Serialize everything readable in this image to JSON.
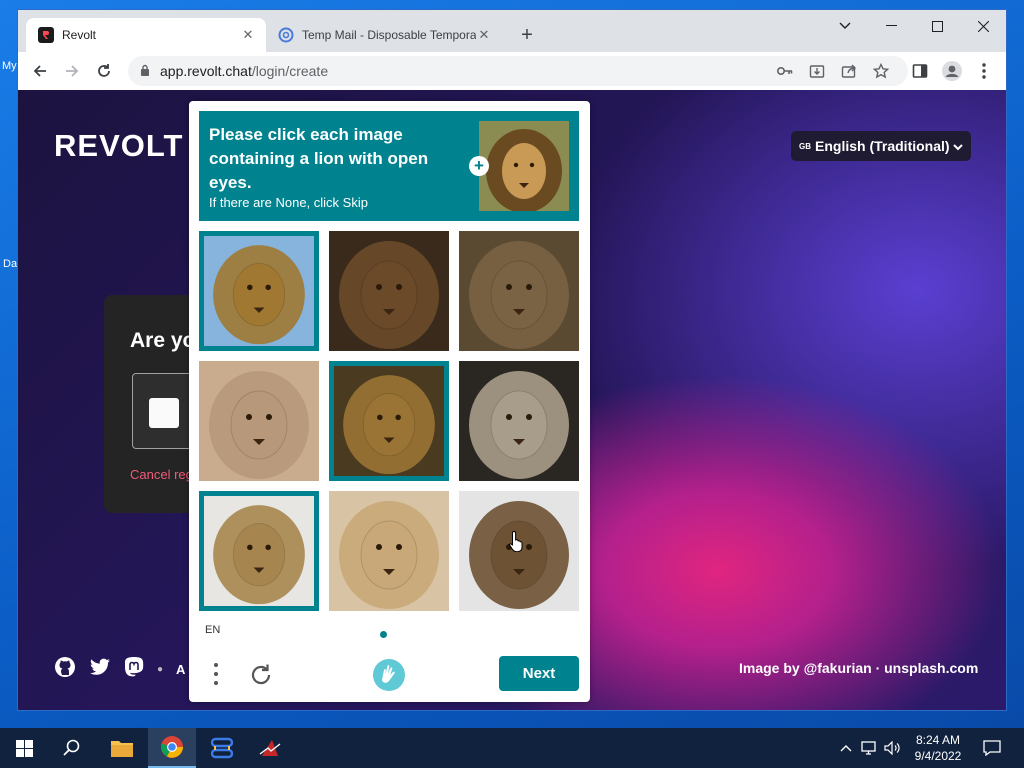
{
  "desktop": {
    "icon_labels": [
      "My",
      "Da"
    ]
  },
  "browser": {
    "tabs": [
      {
        "title": "Revolt",
        "close": "✕"
      },
      {
        "title": "Temp Mail - Disposable Temporary E",
        "close": "✕"
      }
    ],
    "new_tab": "+",
    "url_host": "app.revolt.chat",
    "url_path": "/login/create"
  },
  "page": {
    "logo": "REVOLT",
    "language": {
      "flag": "GB",
      "selected": "English (Traditional)"
    },
    "login_card": {
      "heading": "Are you a human?",
      "cancel": "Cancel registration"
    },
    "footer_letter": "A",
    "credit": "Image by @fakurian · unsplash.com"
  },
  "captcha": {
    "prompt": "Please click each image containing a lion with open eyes.",
    "subprompt": "If there are None, click Skip",
    "language_code": "EN",
    "next_label": "Next",
    "tiles": [
      {
        "selected": true,
        "tone": "#a07832",
        "bg": "#86b4dc"
      },
      {
        "selected": false,
        "tone": "#6b4a2a",
        "bg": "#3a2a1c"
      },
      {
        "selected": false,
        "tone": "#7a6244",
        "bg": "#5b4a32"
      },
      {
        "selected": false,
        "tone": "#b8987a",
        "bg": "#c9ab8e"
      },
      {
        "selected": true,
        "tone": "#9a7434",
        "bg": "#4a3a20"
      },
      {
        "selected": false,
        "tone": "#a89c8a",
        "bg": "#2a2622"
      },
      {
        "selected": true,
        "tone": "#a6864e",
        "bg": "#e8e6e2"
      },
      {
        "selected": false,
        "tone": "#c8a878",
        "bg": "#d8c4a4"
      },
      {
        "selected": false,
        "tone": "#6e5234",
        "bg": "#e4e4e4"
      }
    ]
  },
  "taskbar": {
    "time": "8:24 AM",
    "date": "9/4/2022"
  }
}
